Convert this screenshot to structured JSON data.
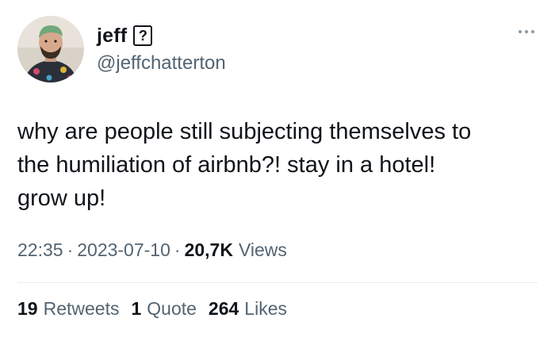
{
  "author": {
    "display_name": "jeff",
    "badge_glyph": "?",
    "handle": "@jeffchatterton",
    "avatar_icon": "user-avatar"
  },
  "menu": {
    "icon": "more-horizontal-icon"
  },
  "tweet": {
    "text_lines": [
      "why are people still subjecting themselves to",
      "the humiliation of airbnb?! stay in a hotel!",
      "grow up!"
    ],
    "time": "22:35",
    "separator": "·",
    "date": "2023-07-10",
    "views_count": "20,7K",
    "views_label": "Views"
  },
  "stats": {
    "retweets_count": "19",
    "retweets_label": "Retweets",
    "quotes_count": "1",
    "quotes_label": "Quote",
    "likes_count": "264",
    "likes_label": "Likes"
  },
  "colors": {
    "text_primary": "#0f1419",
    "text_secondary": "#536471",
    "divider": "#e6ecf0"
  }
}
